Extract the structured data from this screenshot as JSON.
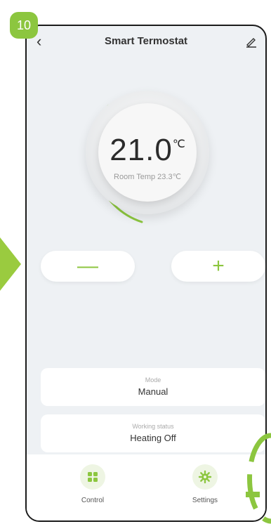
{
  "step": "10",
  "header": {
    "title": "Smart Termostat"
  },
  "thermostat": {
    "set_temp": "21.0",
    "unit": "℃",
    "room_temp": "Room Temp 23.3℃"
  },
  "controls": {
    "minus_label": "—",
    "plus_label": "+"
  },
  "cards": {
    "mode": {
      "label": "Mode",
      "value": "Manual"
    },
    "status": {
      "label": "Working status",
      "value": "Heating Off"
    }
  },
  "nav": {
    "items": [
      {
        "label": "Control",
        "icon": "grid-icon"
      },
      {
        "label": "Settings",
        "icon": "gear-icon"
      }
    ]
  },
  "colors": {
    "accent": "#8cc63f",
    "arrow": "#9acb3f",
    "background": "#eef1f4"
  }
}
